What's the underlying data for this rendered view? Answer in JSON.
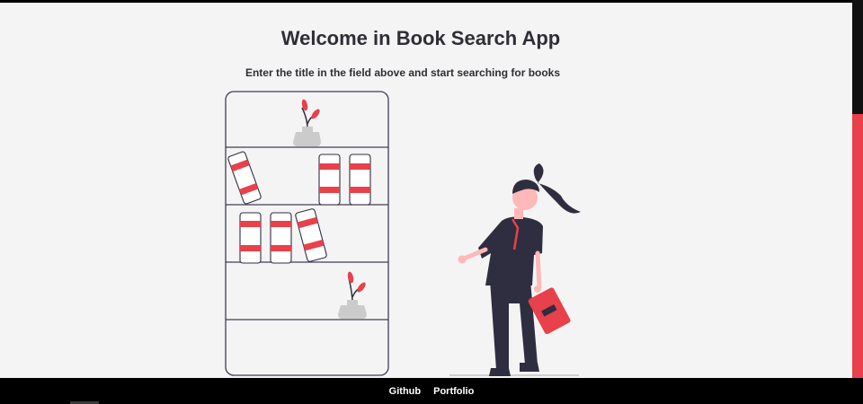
{
  "header": {
    "title": "Welcome in Book Search App",
    "subtitle": "Enter the title in the field above and start searching for books"
  },
  "footer": {
    "links": [
      {
        "label": "Github"
      },
      {
        "label": "Portfolio"
      }
    ]
  },
  "colors": {
    "accent": "#e8414b",
    "dark": "#2f2e41",
    "background": "#f5f4f4"
  },
  "illustration": {
    "icon": "woman-reading-book-icon"
  }
}
